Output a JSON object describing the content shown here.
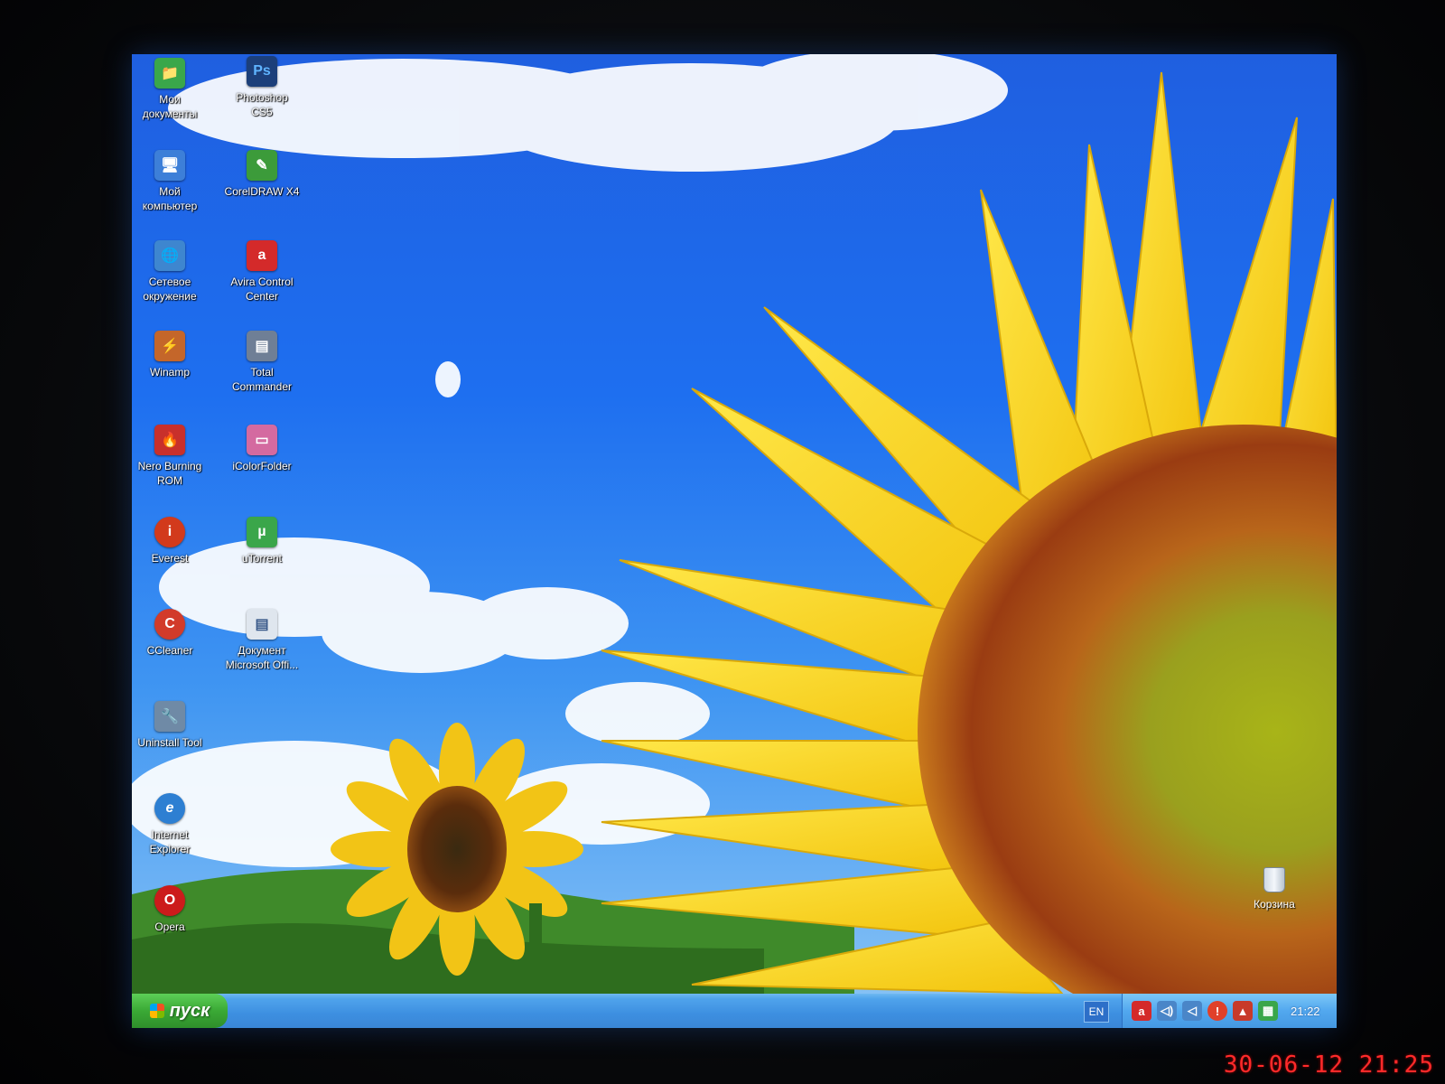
{
  "desktop": {
    "icons_col1": [
      {
        "label": "Мои\nдокументы",
        "icon": "my-documents-icon",
        "color": "#3aa74a",
        "glyph": "📁"
      },
      {
        "label": "Мой\nкомпьютер",
        "icon": "my-computer-icon",
        "color": "#3d7fd8",
        "glyph": "🖥"
      },
      {
        "label": "Сетевое\nокружение",
        "icon": "network-places-icon",
        "color": "#3e86cf",
        "glyph": "🌐"
      },
      {
        "label": "Winamp",
        "icon": "winamp-icon",
        "color": "#c4662a",
        "glyph": "⚡"
      },
      {
        "label": "Nero Burning\nROM",
        "icon": "nero-icon",
        "color": "#c8302b",
        "glyph": "🔥"
      },
      {
        "label": "Everest",
        "icon": "everest-icon",
        "color": "#d23a1c",
        "glyph": "i"
      },
      {
        "label": "CCleaner",
        "icon": "ccleaner-icon",
        "color": "#d23b2a",
        "glyph": "C"
      },
      {
        "label": "Uninstall Tool",
        "icon": "uninstall-tool-icon",
        "color": "#6f8aa6",
        "glyph": "🔧"
      },
      {
        "label": "Internet\nExplorer",
        "icon": "internet-explorer-icon",
        "color": "#2d7fd2",
        "glyph": "e"
      },
      {
        "label": "Opera",
        "icon": "opera-icon",
        "color": "#cc1b1b",
        "glyph": "O"
      }
    ],
    "icons_col2": [
      {
        "label": "Photoshop\nCS5",
        "icon": "photoshop-icon",
        "color": "#1c3f7a",
        "glyph": "Ps"
      },
      {
        "label": "CorelDRAW X4",
        "icon": "coreldraw-icon",
        "color": "#3c9b3a",
        "glyph": "✎"
      },
      {
        "label": "Avira Control\nCenter",
        "icon": "avira-icon",
        "color": "#d42a2a",
        "glyph": "a"
      },
      {
        "label": "Total\nCommander",
        "icon": "total-commander-icon",
        "color": "#6f7f96",
        "glyph": "▤"
      },
      {
        "label": "iColorFolder",
        "icon": "icolorfolder-icon",
        "color": "#d46aa0",
        "glyph": "▭"
      },
      {
        "label": "uTorrent",
        "icon": "utorrent-icon",
        "color": "#3aa64a",
        "glyph": "µ"
      },
      {
        "label": "Документ\nMicrosoft Offi...",
        "icon": "word-document-icon",
        "color": "#dfe6ee",
        "glyph": "▤"
      }
    ],
    "recycle_bin_label": "Корзина"
  },
  "taskbar": {
    "start_label": "пуск",
    "language": "EN",
    "tray_icons": [
      {
        "icon": "avira-tray-icon",
        "glyph": "a",
        "color": "#d42a2a"
      },
      {
        "icon": "volume-icon",
        "glyph": "🔊",
        "color": "#4a86c8"
      },
      {
        "icon": "volume-mute-icon",
        "glyph": "🔈",
        "color": "#4a86c8"
      },
      {
        "icon": "warning-icon",
        "glyph": "!",
        "color": "#e0402a"
      },
      {
        "icon": "safely-remove-icon",
        "glyph": "▲",
        "color": "#c83a2a"
      },
      {
        "icon": "network-tray-icon",
        "glyph": "▦",
        "color": "#3aa64a"
      }
    ],
    "clock": "21:22"
  },
  "camera_stamp": "30-06-12 21:25"
}
